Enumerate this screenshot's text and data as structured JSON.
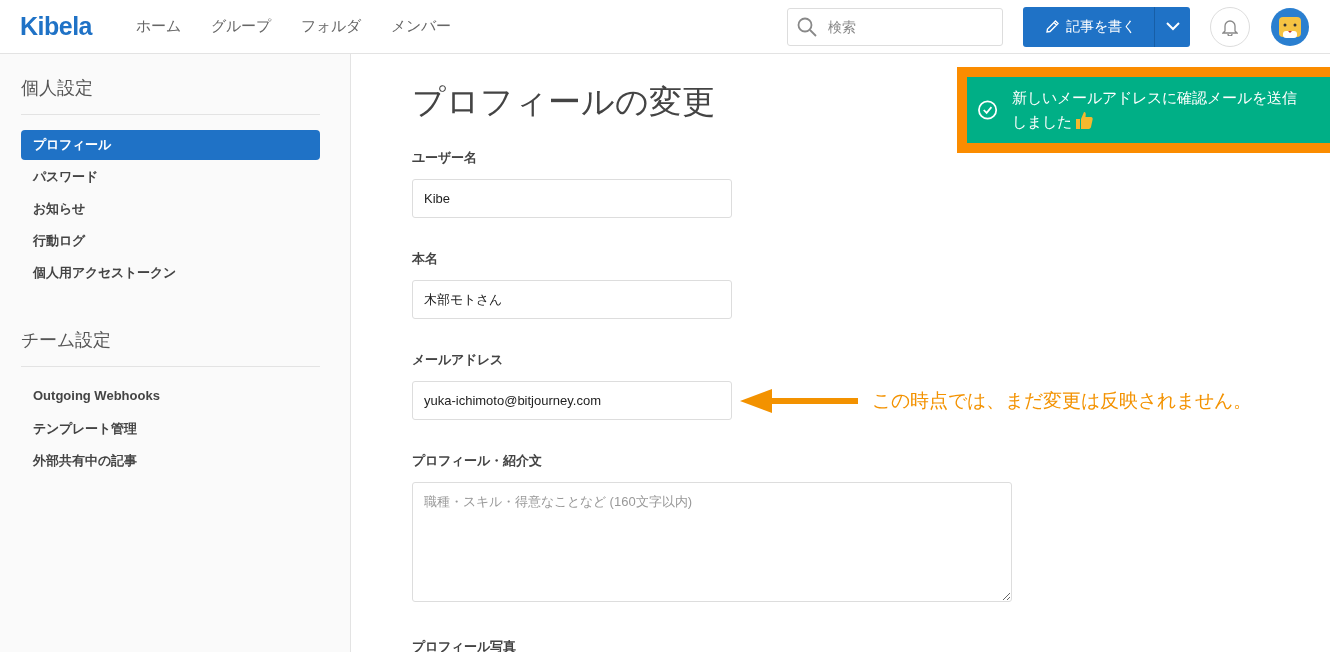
{
  "header": {
    "logo": "Kibela",
    "nav": [
      {
        "label": "ホーム"
      },
      {
        "label": "グループ"
      },
      {
        "label": "フォルダ"
      },
      {
        "label": "メンバー"
      }
    ],
    "search": {
      "placeholder": "検索"
    },
    "write_button": "記事を書く"
  },
  "sidebar": {
    "sections": [
      {
        "title": "個人設定",
        "items": [
          {
            "label": "プロフィール",
            "selected": true
          },
          {
            "label": "パスワード",
            "selected": false
          },
          {
            "label": "お知らせ",
            "selected": false
          },
          {
            "label": "行動ログ",
            "selected": false
          },
          {
            "label": "個人用アクセストークン",
            "selected": false
          }
        ]
      },
      {
        "title": "チーム設定",
        "items": [
          {
            "label": "Outgoing Webhooks",
            "selected": false
          },
          {
            "label": "テンプレート管理",
            "selected": false
          },
          {
            "label": "外部共有中の記事",
            "selected": false
          }
        ]
      }
    ]
  },
  "main": {
    "title": "プロフィールの変更",
    "fields": [
      {
        "kind": "input",
        "label": "ユーザー名",
        "value": "Kibe"
      },
      {
        "kind": "input",
        "label": "本名",
        "value": "木部モトさん"
      },
      {
        "kind": "input",
        "label": "メールアドレス",
        "value": "yuka-ichimoto@bitjourney.com",
        "annotation": "この時点では、まだ変更は反映されません。"
      },
      {
        "kind": "textarea",
        "label": "プロフィール・紹介文",
        "placeholder": "職種・スキル・得意なことなど (160文字以内)"
      },
      {
        "kind": "heading",
        "label": "プロフィール写真"
      }
    ]
  },
  "toast": {
    "lines": [
      "新しいメールアドレスに確認メールを送信",
      "しました"
    ]
  }
}
